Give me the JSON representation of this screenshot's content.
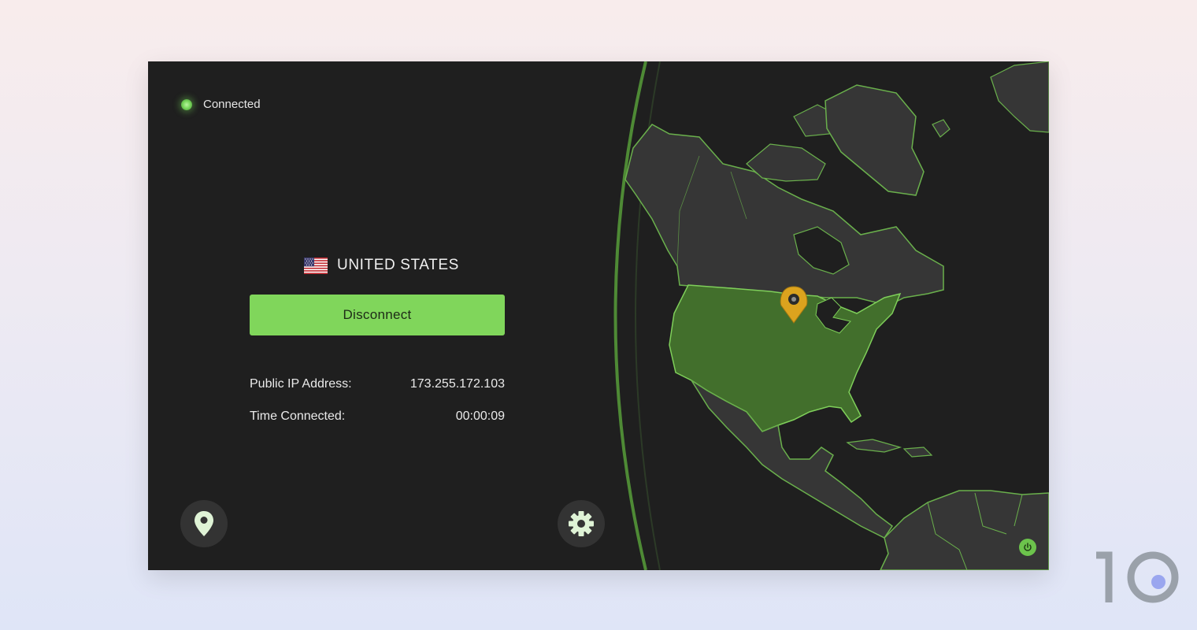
{
  "status": {
    "label": "Connected",
    "color": "#7bd85e"
  },
  "server": {
    "country": "UNITED STATES",
    "flag_icon": "us-flag-icon"
  },
  "actions": {
    "disconnect_label": "Disconnect"
  },
  "info": {
    "ip_label": "Public IP Address:",
    "ip_value": "173.255.172.103",
    "time_label": "Time Connected:",
    "time_value": "00:00:09"
  },
  "nav": {
    "location_icon": "map-pin-icon",
    "settings_icon": "gear-icon",
    "power_icon": "power-icon"
  },
  "map": {
    "marker_icon": "location-marker-icon",
    "highlight_color": "#426f2c",
    "land_color": "#343434",
    "accent_color": "#6ab04c"
  },
  "watermark": {
    "logo": "10"
  },
  "colors": {
    "accent": "#80d65b",
    "background": "#1f1f1f"
  }
}
